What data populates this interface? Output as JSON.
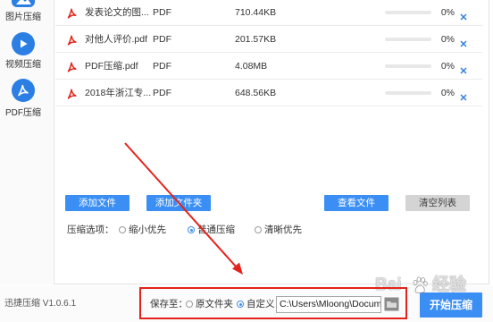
{
  "sidebar": {
    "items": [
      {
        "label": "图片压缩",
        "icon": "image-icon"
      },
      {
        "label": "视频压缩",
        "icon": "video-play-icon"
      },
      {
        "label": "PDF压缩",
        "icon": "pdf-icon"
      }
    ]
  },
  "files": [
    {
      "name": "发表论文的图...",
      "type": "PDF",
      "size": "710.44KB",
      "progress": 0,
      "progress_label": "0%"
    },
    {
      "name": "对他人评价.pdf",
      "type": "PDF",
      "size": "201.57KB",
      "progress": 0,
      "progress_label": "0%"
    },
    {
      "name": "PDF压缩.pdf",
      "type": "PDF",
      "size": "4.08MB",
      "progress": 0,
      "progress_label": "0%"
    },
    {
      "name": "2018年浙江专...",
      "type": "PDF",
      "size": "648.56KB",
      "progress": 0,
      "progress_label": "0%"
    }
  ],
  "actions": {
    "add_file": "添加文件",
    "add_folder": "添加文件夹",
    "view_files": "查看文件",
    "clear_list": "清空列表"
  },
  "compression": {
    "label": "压缩选项：",
    "options": [
      "缩小优先",
      "普通压缩",
      "清晰优先"
    ],
    "selected": "普通压缩"
  },
  "save": {
    "label": "保存至：",
    "options": [
      "原文件夹",
      "自定义"
    ],
    "selected": "自定义",
    "path": "C:\\Users\\Mloong\\Docume",
    "browse_icon": "folder-icon"
  },
  "start_button": "开始压缩",
  "version": "迅捷压缩 V1.0.6.1",
  "watermark": {
    "left": "Bai",
    "right": "经验"
  },
  "colors": {
    "accent": "#3b8ff4",
    "sidebar_icon": "#2b7ee4",
    "button_disabled": "#d4d4d4",
    "pdf_icon": "#e2231a",
    "annotation": "#e3231b"
  }
}
